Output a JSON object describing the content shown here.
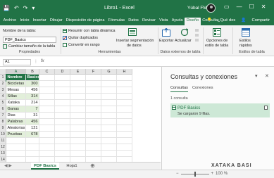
{
  "titlebar": {
    "qat": [
      "💾",
      "↶",
      "↷",
      "▾"
    ],
    "document_title": "Libro1 - Excel",
    "user_name": "Yúbal FM",
    "window_buttons": [
      "▭",
      "—",
      "☐",
      "✕"
    ]
  },
  "tabs": {
    "items": [
      "Archivo",
      "Inicio",
      "Insertar",
      "Dibujar",
      "Disposición de página",
      "Fórmulas",
      "Datos",
      "Revisar",
      "Vista",
      "Ayuda",
      "Diseño",
      "Consulta"
    ],
    "active": "Diseño",
    "tell_me": "¿Qué des",
    "share": "Compartir",
    "tell_me_icon": "lightbulb-icon",
    "share_icon": "person-plus-icon"
  },
  "ribbon": {
    "propiedades": {
      "name_label": "Nombre de la tabla:",
      "name_value": "PDF_Basics",
      "resize_label": "Cambiar tamaño de la tabla",
      "group_label": "Propiedades"
    },
    "herramientas": {
      "pivot_label": "Resumir con tabla dinámica",
      "dedupe_label": "Quitar duplicados",
      "convert_label": "Convertir en rango",
      "slicer_label_1": "Insertar segmentación",
      "slicer_label_2": "de datos",
      "group_label": "Herramientas"
    },
    "datos_externos": {
      "export_label": "Exportar",
      "refresh_label": "Actualizar",
      "group_label": "Datos externos de tabla"
    },
    "opciones": {
      "options_label_1": "Opciones de",
      "options_label_2": "estilo de tabla",
      "group_label": ""
    },
    "estilos": {
      "quick_label_1": "Estilos",
      "quick_label_2": "rápidos",
      "group_label": "Estilos de tabla"
    }
  },
  "formula_bar": {
    "cell_ref": "A1",
    "fx": "fx",
    "cancel": "✕",
    "enter": "✓"
  },
  "grid": {
    "columns": [
      "A",
      "B",
      "C",
      "D",
      "E",
      "F",
      "G",
      "H"
    ],
    "rows": [
      "1",
      "2",
      "3",
      "4",
      "5",
      "6",
      "7",
      "8",
      "9",
      "10",
      "11",
      "12",
      "13",
      "14"
    ],
    "table_headers": [
      "Nombre",
      "Basics"
    ],
    "table_rows": [
      [
        "Bicicletas",
        "300"
      ],
      [
        "Mesas",
        "456"
      ],
      [
        "Sillas",
        "314"
      ],
      [
        "Xataka",
        "214"
      ],
      [
        "Ganas",
        "7"
      ],
      [
        "Dias",
        "31"
      ],
      [
        "Palabras",
        "456"
      ],
      [
        "Aleatorias",
        "121"
      ],
      [
        "Pruebas",
        "678"
      ]
    ]
  },
  "sheets": {
    "nav": "◀ ▶",
    "tabs": [
      "PDF Basics",
      "Hoja1"
    ],
    "active": "PDF Basics",
    "add": "⊕"
  },
  "pane": {
    "title": "Consultas y conexiones",
    "collapse": "▾",
    "close": "✕",
    "tab_queries": "Consultas",
    "tab_connections": "Conexiones",
    "count": "1 consulta",
    "query_name": "PDF Basics",
    "query_status": "Se cargaron 9 filas."
  },
  "status": {
    "zoom_minus": "−",
    "zoom_plus": "+",
    "zoom": "100 %"
  },
  "watermark": "XATAKA BASI",
  "colors": {
    "excel_green": "#217346",
    "table_band": "#e2efda",
    "query_card": "#cde8d6"
  }
}
